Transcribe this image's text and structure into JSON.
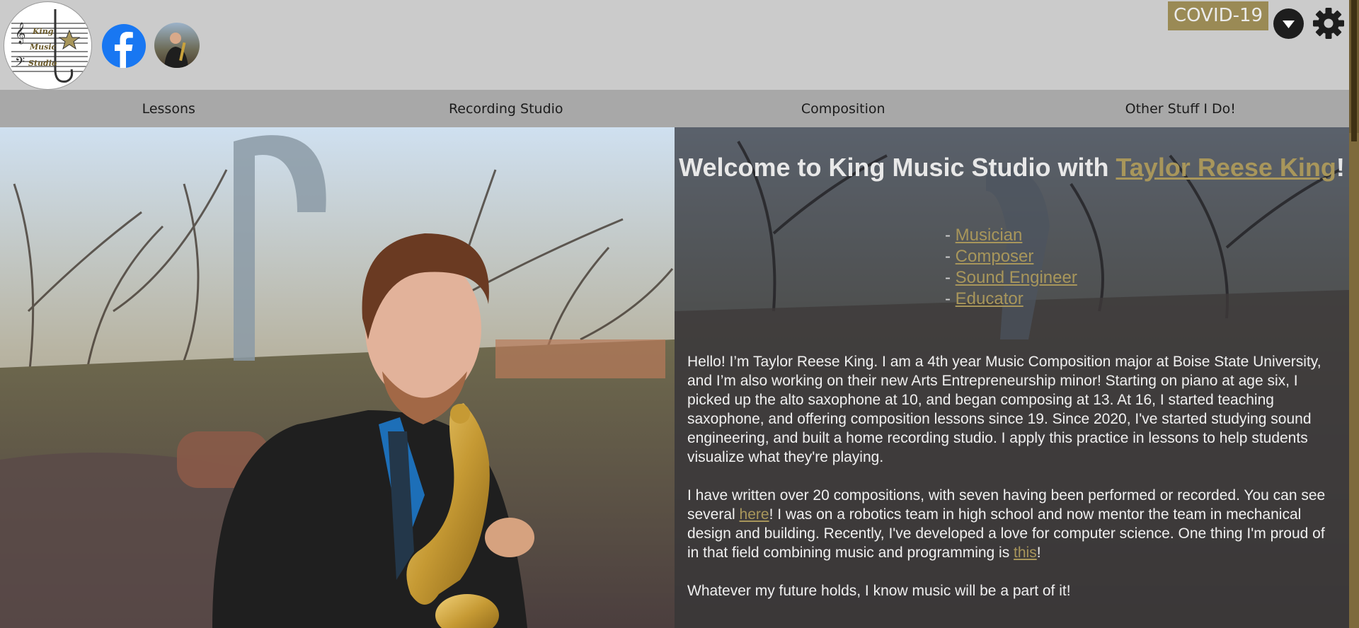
{
  "header": {
    "logo": {
      "lines": [
        "King",
        "Music",
        "Studio"
      ]
    },
    "facebook_icon": "facebook-icon",
    "avatar": "profile-photo",
    "covid_label": "COVID-19",
    "dropdown_icon": "chevron-down-icon",
    "settings_icon": "gear-icon"
  },
  "nav": {
    "items": [
      {
        "label": "Lessons"
      },
      {
        "label": "Recording Studio"
      },
      {
        "label": "Composition"
      },
      {
        "label": "Other Stuff I Do!"
      }
    ]
  },
  "hero": {
    "welcome_prefix": "Welcome to King Music Studio with ",
    "welcome_link": "Taylor Reese King",
    "welcome_suffix": "!",
    "roles": [
      {
        "dash": "- ",
        "label": "Musician"
      },
      {
        "dash": "- ",
        "label": "Composer"
      },
      {
        "dash": "- ",
        "label": "Sound Engineer"
      },
      {
        "dash": "- ",
        "label": "Educator"
      }
    ],
    "bio_p1": "Hello! I’m Taylor Reese King. I am a 4th year Music Composition major at Boise State University, and I’m also working on their new Arts Entrepreneurship minor! Starting on piano at age six, I picked up the alto saxophone at 10, and began composing at 13. At 16, I started teaching saxophone, and offering composition lessons since 19. Since 2020, I've started studying sound engineering, and built a home recording studio. I apply this practice in lessons to help students visualize what they're playing.",
    "bio_p2_a": "I have written over 20 compositions, with seven having been performed or recorded. You can see several ",
    "bio_p2_link1": "here",
    "bio_p2_b": "! I was on a robotics team in high school and now mentor the team in mechanical design and building. Recently, I've developed a love for computer science. One thing I'm proud of in that field combining music and programming is ",
    "bio_p2_link2": "this",
    "bio_p2_c": "!",
    "bio_p3": "Whatever my future holds, I know music will be a part of it!"
  },
  "colors": {
    "accent_gold": "#a8965b",
    "header_bg": "#cbcbcb",
    "nav_bg": "#a8a8a8",
    "covid_bg": "#9a8a55"
  }
}
